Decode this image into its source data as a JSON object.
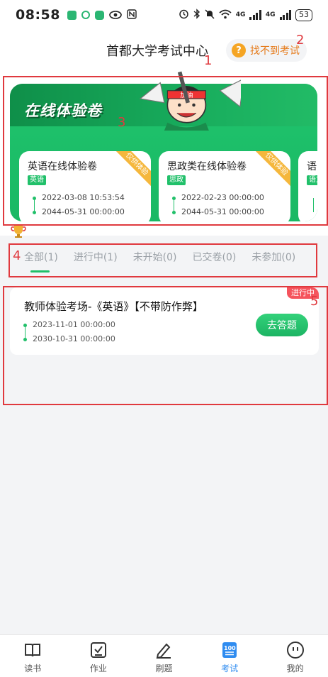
{
  "status_bar": {
    "time": "08:58",
    "network_1": "4G",
    "network_2": "4G",
    "battery": "53"
  },
  "header": {
    "title": "首都大学考试中心",
    "help_label": "找不到考试",
    "help_icon": "?"
  },
  "banner": {
    "title": "在线体验卷",
    "mascot_text": "加油",
    "cards": [
      {
        "title": "英语在线体验卷",
        "tag": "英语",
        "start": "2022-03-08 10:53:54",
        "end": "2044-05-31 00:00:00",
        "ribbon": "仅供体验"
      },
      {
        "title": "思政类在线体验卷",
        "tag": "思政",
        "start": "2022-02-23 00:00:00",
        "end": "2044-05-31 00:00:00",
        "ribbon": "仅供体验"
      },
      {
        "title": "语",
        "tag": "语文"
      }
    ]
  },
  "tabs": [
    {
      "label": "全部(1)",
      "active": true
    },
    {
      "label": "进行中(1)",
      "active": false
    },
    {
      "label": "未开始(0)",
      "active": false
    },
    {
      "label": "已交卷(0)",
      "active": false
    },
    {
      "label": "未参加(0)",
      "active": false
    }
  ],
  "exam_list": [
    {
      "name": "教师体验考场-《英语》【不带防作弊】",
      "status": "进行中",
      "start": "2023-11-01 00:00:00",
      "end": "2030-10-31 00:00:00",
      "action": "去答题"
    }
  ],
  "annotations": [
    "1",
    "2",
    "3",
    "4",
    "5"
  ],
  "bottom_nav": [
    {
      "label": "读书",
      "icon": "book-icon",
      "active": false
    },
    {
      "label": "作业",
      "icon": "homework-check-icon",
      "active": false
    },
    {
      "label": "刷题",
      "icon": "pencil-icon",
      "active": false
    },
    {
      "label": "考试",
      "icon": "exam-100-icon",
      "active": true
    },
    {
      "label": "我的",
      "icon": "profile-face-icon",
      "active": false
    }
  ],
  "colors": {
    "accent_green": "#21c06a",
    "status_red": "#f5545d",
    "nav_active_blue": "#2f8cf0",
    "help_orange": "#e57a1a"
  }
}
